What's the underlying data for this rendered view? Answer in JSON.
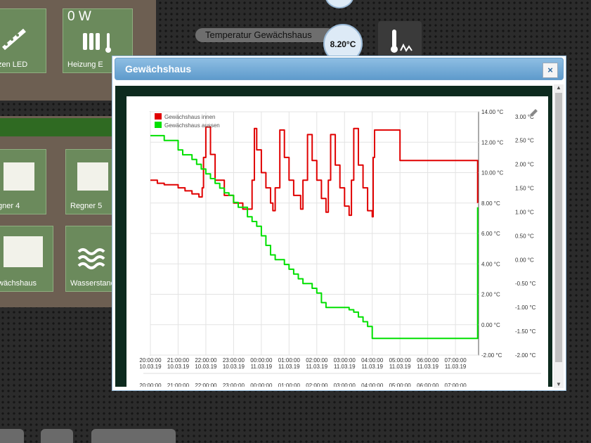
{
  "tiles": {
    "led": {
      "label": "zen LED"
    },
    "heizung": {
      "power": "0 W",
      "label": "Heizung E"
    },
    "regner4": {
      "label": "gner 4"
    },
    "regner5": {
      "label": "Regner 5"
    },
    "gewaechshaus": {
      "label": "wächshaus"
    },
    "wasserstand": {
      "label": "Wasserstand"
    }
  },
  "sensor": {
    "name": "Temperatur Gewächshaus",
    "value": "8.20°C"
  },
  "dialog": {
    "title": "Gewächshaus",
    "close": "×"
  },
  "colors": {
    "innen": "#e00000",
    "aussen": "#00e000",
    "header": "#6ea6d3",
    "content_bg": "#0d2a1e"
  },
  "chart_data": {
    "type": "line",
    "legend_position": "top-left",
    "grid": true,
    "x_ticks": [
      {
        "time": "20:00:00",
        "date": "10.03.19"
      },
      {
        "time": "21:00:00",
        "date": "10.03.19"
      },
      {
        "time": "22:00:00",
        "date": "10.03.19"
      },
      {
        "time": "23:00:00",
        "date": "10.03.19"
      },
      {
        "time": "00:00:00",
        "date": "11.03.19"
      },
      {
        "time": "01:00:00",
        "date": "11.03.19"
      },
      {
        "time": "02:00:00",
        "date": "11.03.19"
      },
      {
        "time": "03:00:00",
        "date": "11.03.19"
      },
      {
        "time": "04:00:00",
        "date": "11.03.19"
      },
      {
        "time": "05:00:00",
        "date": "11.03.19"
      },
      {
        "time": "06:00:00",
        "date": "11.03.19"
      },
      {
        "time": "07:00:00",
        "date": "11.03.19"
      }
    ],
    "x_range": [
      "2019-03-10 20:00",
      "2019-03-11 07:50"
    ],
    "y_left": {
      "range": [
        -2,
        14
      ],
      "ticks": [
        "14.00 °C",
        "12.00 °C",
        "10.00 °C",
        "8.00 °C",
        "6.00 °C",
        "4.00 °C",
        "2.00 °C",
        "0.00 °C",
        "-2.00 °C"
      ]
    },
    "y_right": {
      "range": [
        -2,
        3.1
      ],
      "ticks": [
        "3.00 °C",
        "2.50 °C",
        "2.00 °C",
        "1.50 °C",
        "1.00 °C",
        "0.50 °C",
        "0.00 °C",
        "-0.50 °C",
        "-1.00 °C",
        "-1.50 °C",
        "-2.00 °C"
      ]
    },
    "series": [
      {
        "name": "Gewächshaus innen",
        "axis": "left",
        "x": [
          "2019-03-10 20:00",
          "2019-03-10 20:15",
          "2019-03-10 20:30",
          "2019-03-10 20:45",
          "2019-03-10 21:00",
          "2019-03-10 21:15",
          "2019-03-10 21:30",
          "2019-03-10 21:45",
          "2019-03-10 21:50",
          "2019-03-10 21:52",
          "2019-03-10 21:55",
          "2019-03-10 22:00",
          "2019-03-10 22:10",
          "2019-03-10 22:20",
          "2019-03-10 22:40",
          "2019-03-10 23:00",
          "2019-03-10 23:20",
          "2019-03-10 23:35",
          "2019-03-10 23:40",
          "2019-03-10 23:45",
          "2019-03-10 23:50",
          "2019-03-11 00:00",
          "2019-03-11 00:10",
          "2019-03-11 00:20",
          "2019-03-11 00:25",
          "2019-03-11 00:30",
          "2019-03-11 00:40",
          "2019-03-11 00:50",
          "2019-03-11 01:00",
          "2019-03-11 01:10",
          "2019-03-11 01:25",
          "2019-03-11 01:30",
          "2019-03-11 01:40",
          "2019-03-11 01:50",
          "2019-03-11 02:00",
          "2019-03-11 02:10",
          "2019-03-11 02:20",
          "2019-03-11 02:25",
          "2019-03-11 02:30",
          "2019-03-11 02:40",
          "2019-03-11 02:50",
          "2019-03-11 03:00",
          "2019-03-11 03:10",
          "2019-03-11 03:15",
          "2019-03-11 03:20",
          "2019-03-11 03:30",
          "2019-03-11 03:40",
          "2019-03-11 03:50",
          "2019-03-11 04:00",
          "2019-03-11 04:02",
          "2019-03-11 04:05",
          "2019-03-11 05:00",
          "2019-03-11 06:00",
          "2019-03-11 07:00",
          "2019-03-11 07:45",
          "2019-03-11 07:48"
        ],
        "y": [
          9.5,
          9.3,
          9.2,
          9.2,
          9.0,
          8.8,
          8.6,
          8.4,
          8.4,
          9.0,
          11.0,
          13.0,
          11.2,
          9.5,
          8.5,
          8.0,
          7.6,
          7.6,
          9.5,
          12.9,
          11.5,
          10.0,
          9.0,
          8.0,
          7.5,
          9.0,
          12.8,
          11.0,
          9.5,
          8.5,
          7.6,
          9.5,
          12.5,
          10.8,
          9.5,
          8.3,
          7.4,
          9.5,
          12.5,
          10.5,
          9.0,
          7.8,
          7.2,
          9.5,
          12.9,
          10.5,
          9.0,
          7.5,
          7.1,
          11.0,
          12.8,
          10.8,
          10.8,
          10.8,
          10.8,
          8.0
        ]
      },
      {
        "name": "Gewächshaus aussen",
        "axis": "right",
        "x": [
          "2019-03-10 20:00",
          "2019-03-10 20:15",
          "2019-03-10 20:30",
          "2019-03-10 20:45",
          "2019-03-10 21:00",
          "2019-03-10 21:10",
          "2019-03-10 21:20",
          "2019-03-10 21:30",
          "2019-03-10 21:40",
          "2019-03-10 21:50",
          "2019-03-10 22:00",
          "2019-03-10 22:10",
          "2019-03-10 22:20",
          "2019-03-10 22:30",
          "2019-03-10 22:40",
          "2019-03-10 22:50",
          "2019-03-10 23:00",
          "2019-03-10 23:10",
          "2019-03-10 23:20",
          "2019-03-10 23:30",
          "2019-03-10 23:40",
          "2019-03-10 23:50",
          "2019-03-11 00:00",
          "2019-03-11 00:10",
          "2019-03-11 00:20",
          "2019-03-11 00:30",
          "2019-03-11 00:40",
          "2019-03-11 00:50",
          "2019-03-11 01:00",
          "2019-03-11 01:10",
          "2019-03-11 01:20",
          "2019-03-11 01:30",
          "2019-03-11 01:40",
          "2019-03-11 01:50",
          "2019-03-11 02:00",
          "2019-03-11 02:10",
          "2019-03-11 02:20",
          "2019-03-11 02:30",
          "2019-03-11 02:40",
          "2019-03-11 02:50",
          "2019-03-11 03:00",
          "2019-03-11 03:10",
          "2019-03-11 03:20",
          "2019-03-11 03:30",
          "2019-03-11 03:40",
          "2019-03-11 03:50",
          "2019-03-11 04:00",
          "2019-03-11 05:00",
          "2019-03-11 06:00",
          "2019-03-11 07:00",
          "2019-03-11 07:45",
          "2019-03-11 07:48"
        ],
        "y": [
          2.6,
          2.6,
          2.5,
          2.5,
          2.3,
          2.2,
          2.2,
          2.1,
          2.0,
          1.9,
          1.8,
          1.7,
          1.6,
          1.5,
          1.4,
          1.35,
          1.2,
          1.1,
          1.1,
          0.9,
          0.8,
          0.7,
          0.5,
          0.3,
          0.1,
          0.0,
          0.0,
          -0.1,
          -0.2,
          -0.3,
          -0.4,
          -0.5,
          -0.5,
          -0.6,
          -0.7,
          -0.9,
          -1.0,
          -1.0,
          -1.0,
          -1.0,
          -1.0,
          -1.05,
          -1.1,
          -1.2,
          -1.3,
          -1.4,
          -1.65,
          -1.65,
          -1.65,
          -1.65,
          -1.65,
          1.1
        ]
      }
    ]
  }
}
